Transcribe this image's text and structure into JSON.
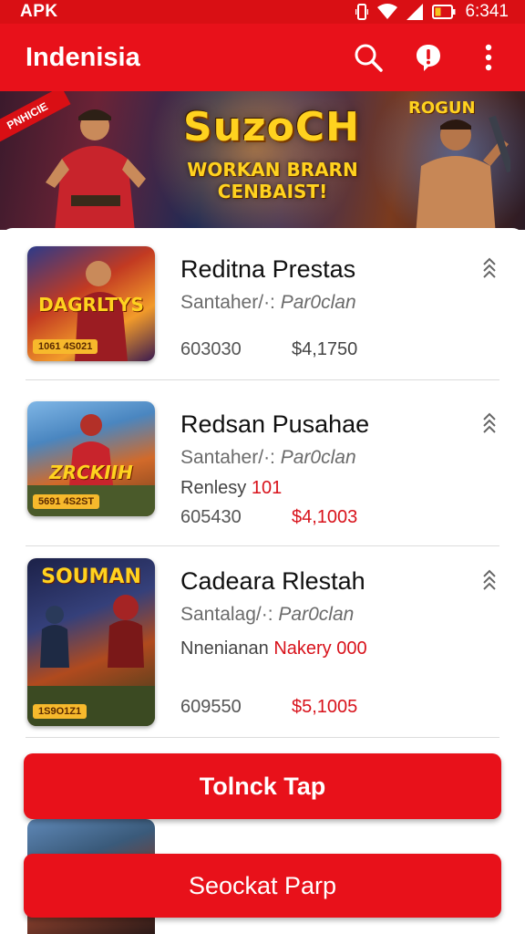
{
  "status_bar": {
    "left_label": "APK",
    "time": "6:341"
  },
  "app_bar": {
    "title": "Indenisia",
    "icons": [
      "search-icon",
      "chat-icon",
      "more-vert-icon"
    ]
  },
  "banner": {
    "ribbon": "PNHICIE",
    "logo": "SuzoCH",
    "tagline_1": "WORKAN BRARN",
    "tagline_2": "CENBAIST!",
    "corner_tag": "ROGUN"
  },
  "items": [
    {
      "name": "Reditna Prestas",
      "sub_label": "Santaher/·:",
      "sub_value": "Par0clan",
      "extra_label": "",
      "extra_value": "",
      "number": "603030",
      "price": "$4,1750",
      "price_color": "#444444",
      "thumb_title": "DAGRLTYS",
      "thumb_badge": "1061 4S021"
    },
    {
      "name": "Redsan Pusahae",
      "sub_label": "Santaher/·:",
      "sub_value": "Par0clan",
      "extra_label": "Renlesy",
      "extra_value": "101",
      "number": "605430",
      "price": "$4,1003",
      "price_color": "#d8121b",
      "thumb_title": "ZRCKIIH",
      "thumb_badge": "5691 4S2ST"
    },
    {
      "name": "Cadeara Rlestah",
      "sub_label": "Santalag/·:",
      "sub_value": "Par0clan",
      "extra_label": "Nnenianan",
      "extra_value": "Nakery 000",
      "number": "609550",
      "price": "$5,1005",
      "price_color": "#d8121b",
      "thumb_title": "SOUMAN",
      "thumb_badge": "1S9O1Z1"
    }
  ],
  "buttons": {
    "primary": "Tolnck Tap",
    "secondary": "Seockat Parp"
  },
  "colors": {
    "brand_red": "#e8111a",
    "price_red": "#d8121b",
    "badge_gold": "#f7b92c"
  }
}
